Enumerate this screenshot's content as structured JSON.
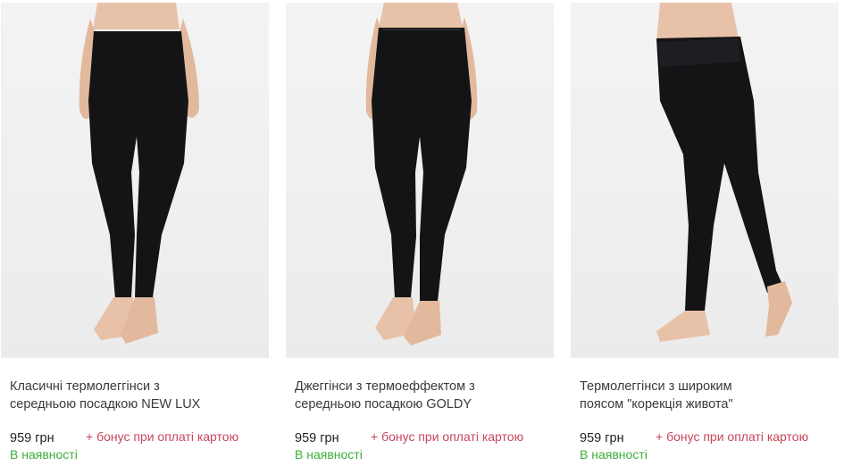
{
  "products": [
    {
      "name_line1": "Класичні термолеггінси з",
      "name_line2": "середньою посадкою NEW LUX",
      "price": "959 грн",
      "bonus": "+ бонус при оплаті картою",
      "stock": "В наявності",
      "image": "black-leggings-classic-photo"
    },
    {
      "name_line1": "Джеггінси з термоеффектом з",
      "name_line2": "середньою посадкою GOLDY",
      "price": "959 грн",
      "bonus": "+ бонус при оплаті картою",
      "stock": "В наявності",
      "image": "black-jeggings-photo"
    },
    {
      "name_line1": "Термолеггінси з широким",
      "name_line2": "поясом \"корекція живота\"",
      "price": "959 грн",
      "bonus": "+ бонус при оплаті картою",
      "stock": "В наявності",
      "image": "black-leggings-wide-waistband-photo"
    }
  ],
  "colors": {
    "bonus": "#c8465a",
    "in_stock": "#3cae3c",
    "photo_background": "#efefef",
    "garment": "#141416",
    "skin": "#e8c2a8"
  }
}
